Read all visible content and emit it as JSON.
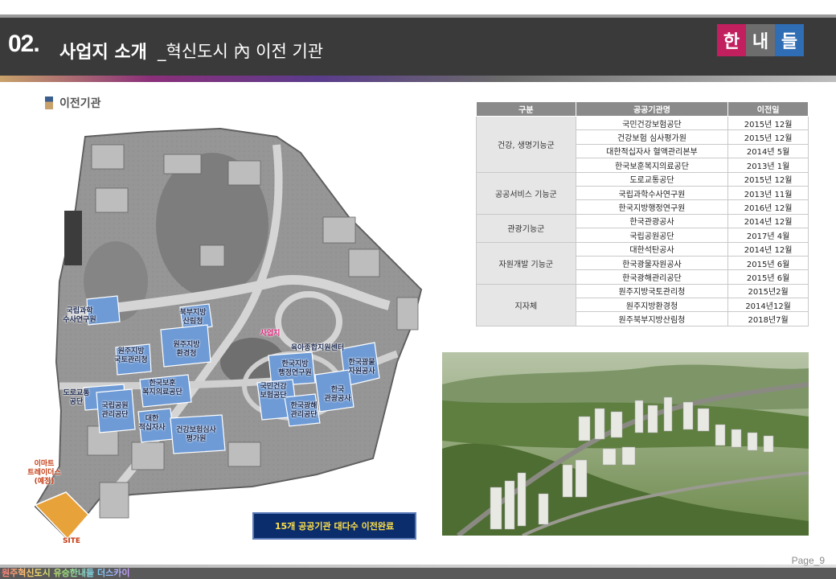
{
  "header": {
    "number": "02.",
    "title": "사업지 소개",
    "subtitle": "_혁신도시 內 이전 기관",
    "logo": [
      "한",
      "내",
      "들"
    ]
  },
  "section": {
    "label": "이전기관"
  },
  "table": {
    "headers": [
      "구분",
      "공공기관명",
      "이전일"
    ],
    "groups": [
      {
        "name": "건강, 생명기능군",
        "rows": [
          {
            "org": "국민건강보험공단",
            "date": "2015년 12월"
          },
          {
            "org": "건강보험 심사평가원",
            "date": "2015년 12월"
          },
          {
            "org": "대한적십자사 혈액관리본부",
            "date": "2014년 5월"
          },
          {
            "org": "한국보훈복지의료공단",
            "date": "2013년 1월"
          }
        ]
      },
      {
        "name": "공공서비스 기능군",
        "rows": [
          {
            "org": "도로교통공단",
            "date": "2015년 12월"
          },
          {
            "org": "국립과학수사연구원",
            "date": "2013년 11월"
          },
          {
            "org": "한국지방행정연구원",
            "date": "2016년 12월"
          }
        ]
      },
      {
        "name": "관광기능군",
        "rows": [
          {
            "org": "한국관광공사",
            "date": "2014년 12월"
          },
          {
            "org": "국립공원공단",
            "date": "2017년 4월"
          }
        ]
      },
      {
        "name": "자원개발 기능군",
        "rows": [
          {
            "org": "대한석탄공사",
            "date": "2014년 12월"
          },
          {
            "org": "한국광물자원공사",
            "date": "2015년 6월"
          },
          {
            "org": "한국광해관리공단",
            "date": "2015년 6월"
          }
        ]
      },
      {
        "name": "지자체",
        "rows": [
          {
            "org": "원주지방국토관리청",
            "date": "2015년2월"
          },
          {
            "org": "원주지방환경청",
            "date": "2014년12월"
          },
          {
            "org": "원주북부지방산림청",
            "date": "2018년7월"
          }
        ]
      }
    ]
  },
  "map": {
    "labels": {
      "l1": "국립과학\n수사연구원",
      "l2": "북부지방\n산림청",
      "l3": "원주지방\n환경청",
      "l4": "원주지방\n국토관리청",
      "l5": "한국보훈\n복지의료공단",
      "l6": "도로교통\n공단",
      "l7": "국립공원\n관리공단",
      "l8": "대한\n적십자사",
      "l9": "건강보험심사\n평가원",
      "l10": "사업지",
      "l11": "육아종합지원센터",
      "l12": "한국지방\n행정연구원",
      "l13": "한국광물\n자원공사",
      "l14": "국민건강\n보험공단",
      "l15": "한국광해\n관리공단",
      "l16": "한국\n관광공사",
      "l17": "이마트\n트레이더스\n(예정)",
      "l18": "SITE"
    },
    "caption": "15개 공공기관 대다수 이전완료"
  },
  "footer": {
    "text": "원주혁신도시 유승한내들 더스카이",
    "page": "Page_9"
  },
  "colors": {
    "header_bg": "#3a3a3a",
    "logo_red": "#c21f5e",
    "logo_gray": "#6d6d6d",
    "logo_blue": "#2f6db5",
    "map_blue": "#6e9bd6"
  }
}
